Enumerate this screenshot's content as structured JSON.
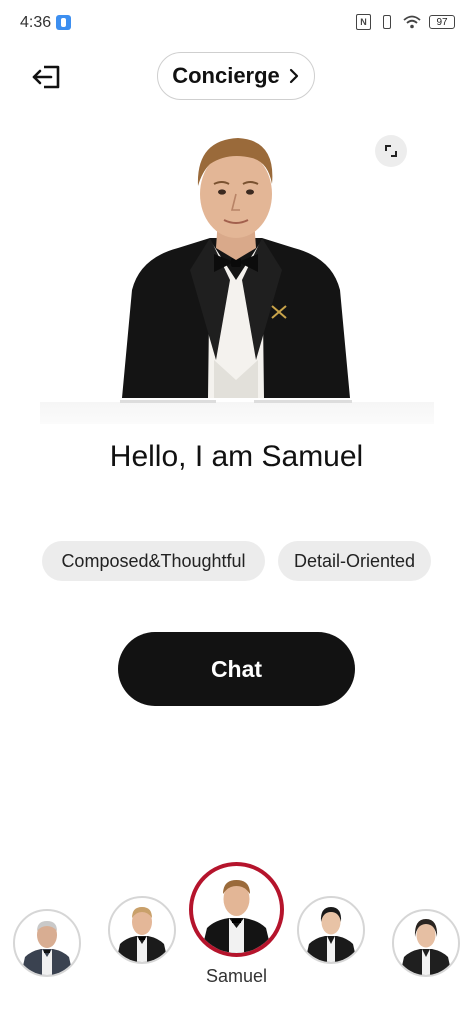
{
  "status_bar": {
    "time": "4:36",
    "battery": "97"
  },
  "header": {
    "title": "Concierge"
  },
  "profile": {
    "greeting": "Hello, I am Samuel",
    "tags": [
      "Composed&Thoughtful",
      "Detail-Oriented"
    ]
  },
  "actions": {
    "chat_label": "Chat"
  },
  "carousel": {
    "selected_name": "Samuel",
    "accent": "#b5142c"
  }
}
